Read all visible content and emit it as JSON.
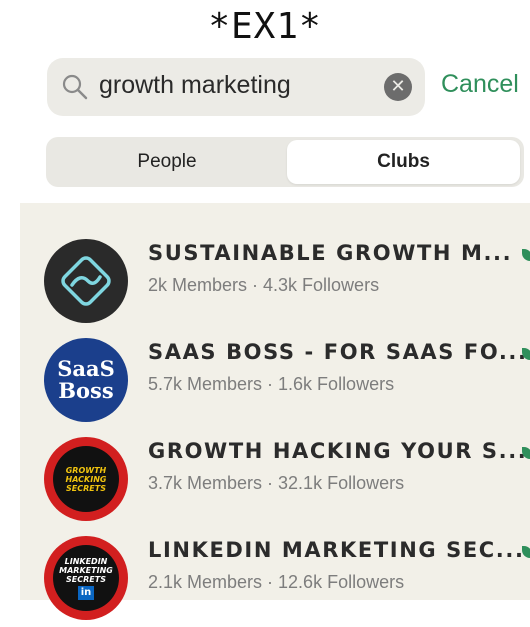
{
  "header": {
    "label": "*EX1*"
  },
  "search": {
    "query": "growth marketing",
    "cancel_label": "Cancel"
  },
  "tabs": [
    {
      "label": "People",
      "selected": false
    },
    {
      "label": "Clubs",
      "selected": true
    }
  ],
  "clubs": [
    {
      "name": "SUSTAINABLE GROWTH M...",
      "stats": "2k Members · 4.3k Followers",
      "avatar_icon": "wave-logo-icon"
    },
    {
      "name": "SAAS BOSS - FOR SAAS FO...",
      "stats": "5.7k Members · 1.6k Followers",
      "avatar_icon": "saas-boss-logo-icon",
      "avatar_text": [
        "SaaS",
        "Boss"
      ]
    },
    {
      "name": "GROWTH HACKING YOUR S...",
      "stats": "3.7k Members · 32.1k Followers",
      "avatar_icon": "growth-hacking-logo-icon",
      "avatar_text": [
        "GROWTH",
        "HACKING",
        "SECRETS"
      ]
    },
    {
      "name": "LINKEDIN MARKETING SEC...",
      "stats": "2.1k Members · 12.6k Followers",
      "avatar_icon": "linkedin-marketing-logo-icon",
      "avatar_text": [
        "LINKEDIN",
        "MARKETING",
        "SECRETS",
        "in"
      ]
    }
  ],
  "colors": {
    "accent": "#2f8f5b",
    "list_bg": "#f2f0e8",
    "search_bg": "#ecebe6"
  }
}
